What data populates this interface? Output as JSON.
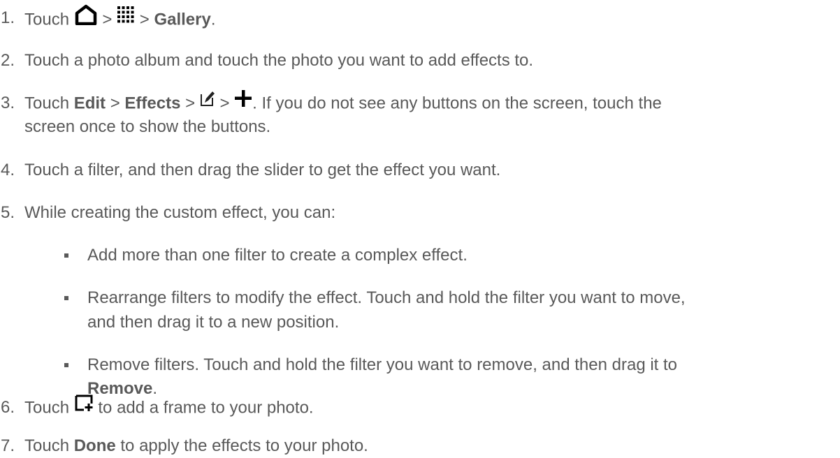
{
  "steps": [
    {
      "num": "1.",
      "pre": "Touch ",
      "home_icon": "home-icon",
      "sep1": " > ",
      "apps_icon": "apps-grid-icon",
      "sep2": " > ",
      "bold1": "Gallery",
      "post": "."
    },
    {
      "num": "2.",
      "text": "Touch a photo album and touch the photo you want to add effects to."
    },
    {
      "num": "3.",
      "pre": "Touch ",
      "bold1": "Edit",
      "sep1": " > ",
      "bold2": "Effects",
      "sep2": " > ",
      "edit_icon": "edit-effect-icon",
      "sep3": " > ",
      "plus_icon": "plus-icon",
      "post": ". If you do not see any buttons on the screen, touch the",
      "line2": "screen once to show the buttons."
    },
    {
      "num": "4.",
      "text": "Touch a filter, and then drag the slider to get the effect you want."
    },
    {
      "num": "5.",
      "text": "While creating the custom effect, you can:"
    },
    {
      "num": "6.",
      "pre": "Touch ",
      "frame_icon": "add-frame-icon",
      "post": " to add a frame to your photo."
    },
    {
      "num": "7.",
      "pre": "Touch ",
      "bold1": "Done",
      "post": " to apply the effects to your photo."
    }
  ],
  "bullets": [
    {
      "text": "Add more than one filter to create a complex effect."
    },
    {
      "line1": "Rearrange filters to modify the effect. Touch and hold the filter you want to move,",
      "line2": "and then drag it to a new position."
    },
    {
      "line1": "Remove filters. Touch and hold the filter you want to remove, and then drag it to",
      "bold": "Remove",
      "post": "."
    }
  ]
}
